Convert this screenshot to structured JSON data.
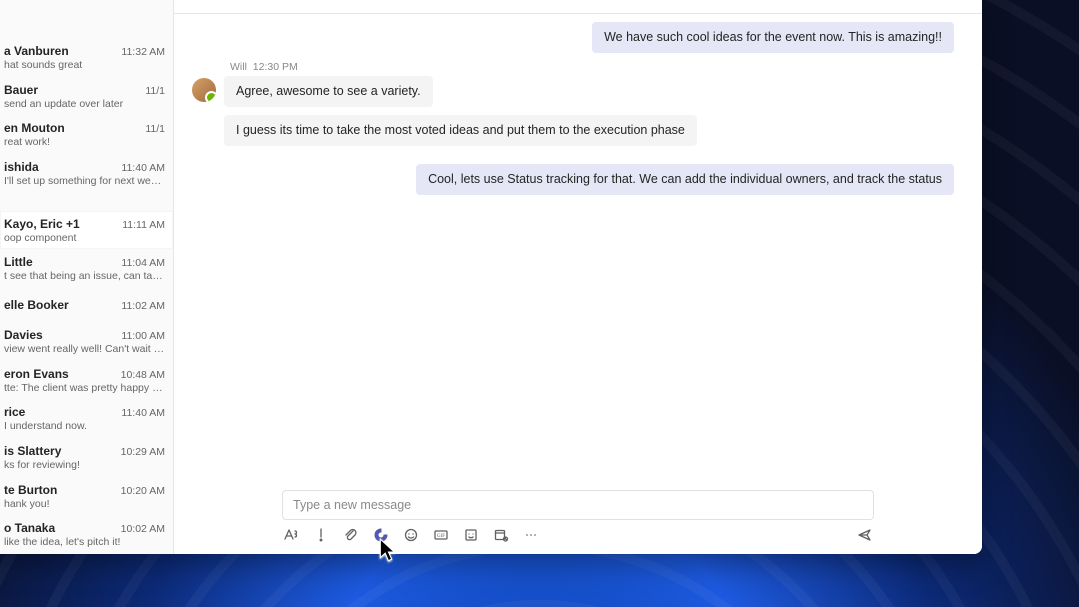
{
  "sidebar": {
    "items": [
      {
        "name": "a Vanburen",
        "time": "11:32 AM",
        "preview": "hat sounds great"
      },
      {
        "name": "Bauer",
        "time": "11/1",
        "preview": "send an update over later"
      },
      {
        "name": "en Mouton",
        "time": "11/1",
        "preview": "reat work!"
      },
      {
        "name": "ishida",
        "time": "11:40 AM",
        "preview": "I'll set up something for next week to…"
      },
      {
        "name": "Kayo, Eric +1",
        "time": "11:11 AM",
        "preview": "oop component"
      },
      {
        "name": "Little",
        "time": "11:04 AM",
        "preview": "t see that being an issue, can take t…"
      },
      {
        "name": "elle Booker",
        "time": "11:02 AM",
        "preview": ""
      },
      {
        "name": "Davies",
        "time": "11:00 AM",
        "preview": "view went really well! Can't wait to…"
      },
      {
        "name": "eron Evans",
        "time": "10:48 AM",
        "preview": "tte: The client was pretty happy with…"
      },
      {
        "name": "rice",
        "time": "11:40 AM",
        "preview": "I understand now."
      },
      {
        "name": "is Slattery",
        "time": "10:29 AM",
        "preview": "ks for reviewing!"
      },
      {
        "name": "te Burton",
        "time": "10:20 AM",
        "preview": "hank you!"
      },
      {
        "name": "o Tanaka",
        "time": "10:02 AM",
        "preview": "like the idea, let's pitch it!"
      }
    ],
    "selectedIndex": 4
  },
  "conversation": {
    "outgoing1": "We have such cool ideas for the event now. This is amazing!!",
    "sender": {
      "name": "Will",
      "time": "12:30 PM"
    },
    "incoming1": "Agree, awesome to see a variety.",
    "incoming2": "I guess its time to take the most voted ideas and put them to the execution phase",
    "outgoing2": "Cool, lets use Status tracking for that. We can add the individual owners, and track the status"
  },
  "composer": {
    "placeholder": "Type a new message"
  }
}
